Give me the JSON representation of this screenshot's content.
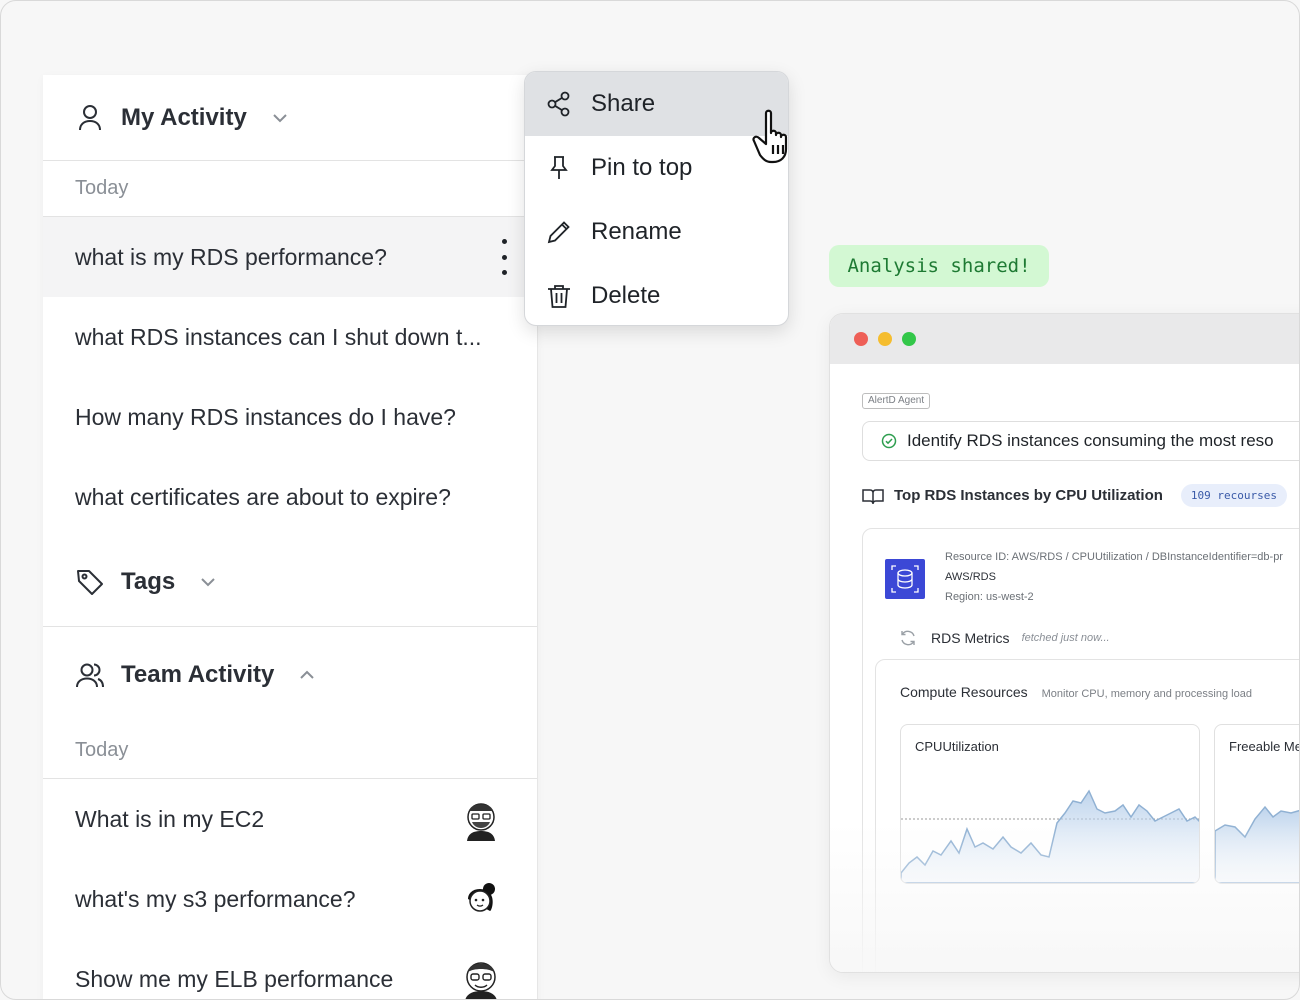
{
  "sidebar": {
    "my_activity": {
      "title": "My Activity",
      "group_label": "Today",
      "items": [
        "what is my RDS performance?",
        "what RDS instances can I shut down t...",
        "How many RDS instances do I have?",
        "what certificates are about to expire?"
      ]
    },
    "tags": {
      "title": "Tags"
    },
    "team_activity": {
      "title": "Team Activity",
      "group_label": "Today",
      "items": [
        "What is in my EC2",
        "what's my s3 performance?",
        "Show me my ELB performance"
      ]
    }
  },
  "context_menu": {
    "items": [
      {
        "label": "Share",
        "icon": "share-icon"
      },
      {
        "label": "Pin to top",
        "icon": "pin-icon"
      },
      {
        "label": "Rename",
        "icon": "pencil-icon"
      },
      {
        "label": "Delete",
        "icon": "trash-icon"
      }
    ]
  },
  "toast": {
    "text": "Analysis shared!"
  },
  "preview": {
    "agent_tag": "AlertD Agent",
    "task": "Identify RDS instances consuming the most reso",
    "section_title": "Top RDS Instances by CPU Utilization",
    "badge": "109 recourses",
    "resource": {
      "id_line": "Resource ID: AWS/RDS / CPUUtilization / DBInstanceIdentifier=db-pr",
      "type": "AWS/RDS",
      "region": "Region: us-west-2"
    },
    "metrics": {
      "title": "RDS Metrics",
      "status": "fetched just now..."
    },
    "compute": {
      "title": "Compute Resources",
      "subtitle": "Monitor CPU, memory and processing load",
      "cards": [
        "CPUUtilization",
        "Freeable Me"
      ]
    }
  },
  "colors": {
    "toast_bg": "#d3f8d3",
    "toast_text": "#1e7a33",
    "accent_blue": "#3b48d6",
    "chart_line": "#8fb3d6"
  }
}
